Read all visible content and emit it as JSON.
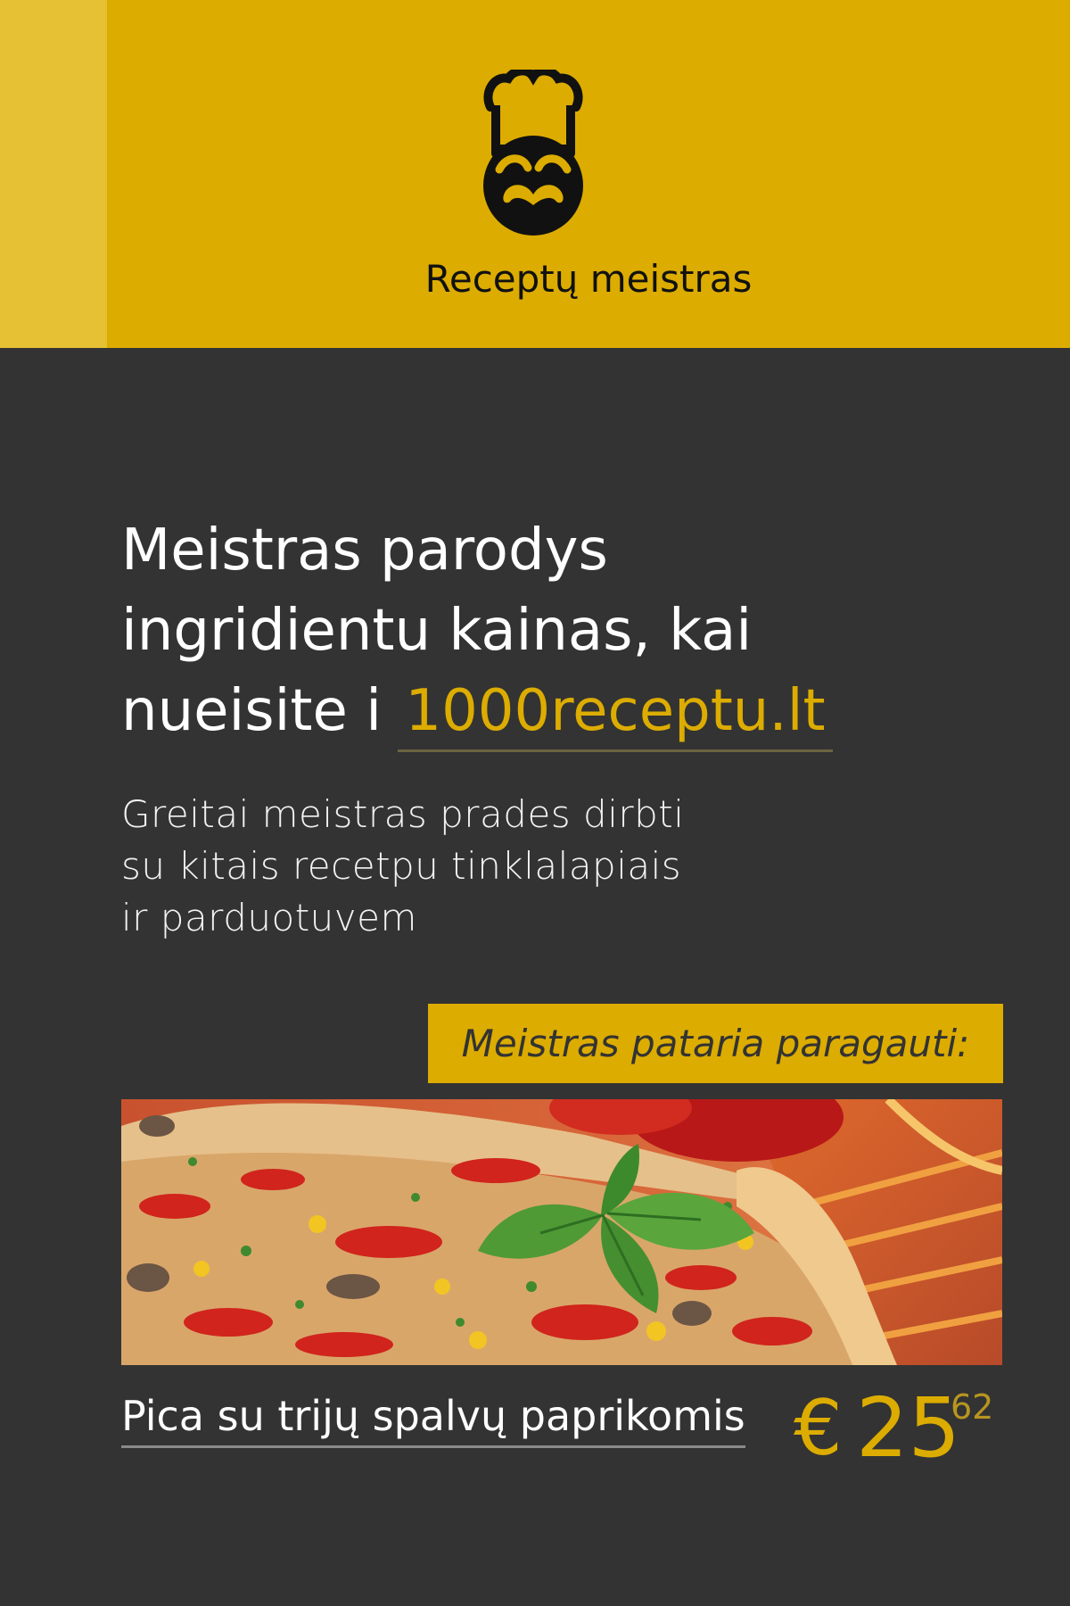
{
  "header": {
    "brand": "Receptų meistras",
    "logo_icon": "chef-mustache-icon",
    "colors": {
      "accent": "#dcac00",
      "strip": "#e5c133"
    }
  },
  "main": {
    "headline_lines": [
      "Meistras parodys",
      "ingridientu kainas, kai",
      "nueisite i"
    ],
    "site_link": "1000receptu.lt",
    "subtext_lines": [
      "Greitai meistras prades dirbti",
      "su kitais recetpu tinklalapiais",
      "ir parduotuvem"
    ],
    "recommend_label": "Meistras pataria paragauti:"
  },
  "recipe": {
    "image_icon": "pizza-photo",
    "title": "Pica su trijų spalvų paprikomis",
    "price_currency": "€",
    "price_main": "25",
    "price_cents": "62"
  },
  "colors": {
    "background": "#333333",
    "accent": "#dcac00"
  }
}
